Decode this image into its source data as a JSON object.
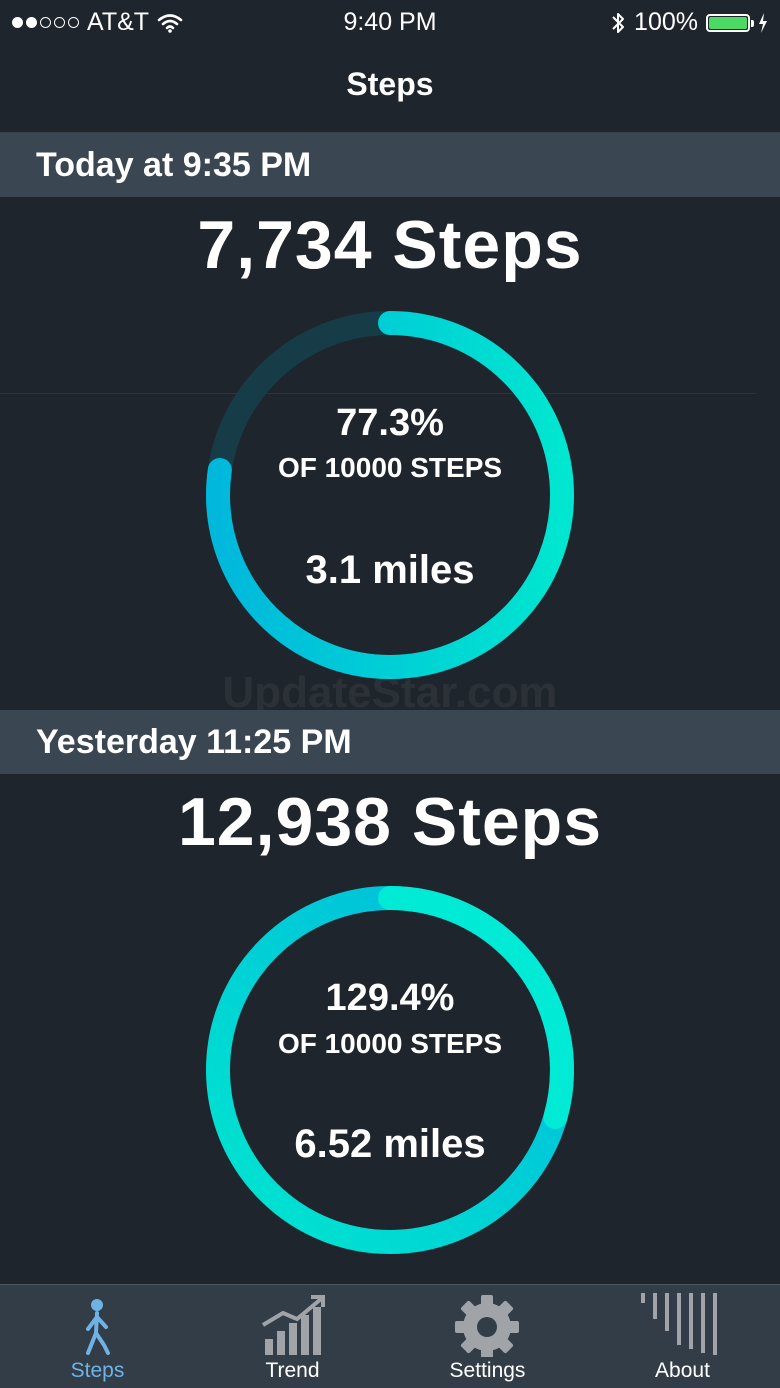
{
  "status_bar": {
    "carrier": "AT&T",
    "time": "9:40 PM",
    "battery": "100%",
    "battery_level": 1.0,
    "signal_bars_filled": 2,
    "signal_bars_total": 5
  },
  "nav": {
    "title": "Steps"
  },
  "today": {
    "header": "Today at 9:35 PM",
    "steps": "7,734 Steps",
    "percent": "77.3%",
    "goal": "OF 10000 STEPS",
    "miles": "3.1 miles",
    "progress": 0.773
  },
  "yesterday": {
    "header": "Yesterday 11:25 PM",
    "steps": "12,938 Steps",
    "percent": "129.4%",
    "goal": "OF 10000 STEPS",
    "miles": "6.52 miles",
    "progress": 1.294
  },
  "watermark": "UpdateStar.com",
  "tabs": [
    {
      "label": "Steps",
      "icon": "walking-person-icon",
      "active": true
    },
    {
      "label": "Trend",
      "icon": "trend-chart-icon",
      "active": false
    },
    {
      "label": "Settings",
      "icon": "gear-icon",
      "active": false
    },
    {
      "label": "About",
      "icon": "bars-icon",
      "active": false
    }
  ],
  "colors": {
    "background": "#1f252c",
    "section_header": "#3a4651",
    "ring_start": "#00e6d0",
    "ring_end": "#00b8dc",
    "ring_track": "#163c48",
    "tab_active": "#6fb3e6",
    "tab_inactive": "#a0a4a8"
  }
}
